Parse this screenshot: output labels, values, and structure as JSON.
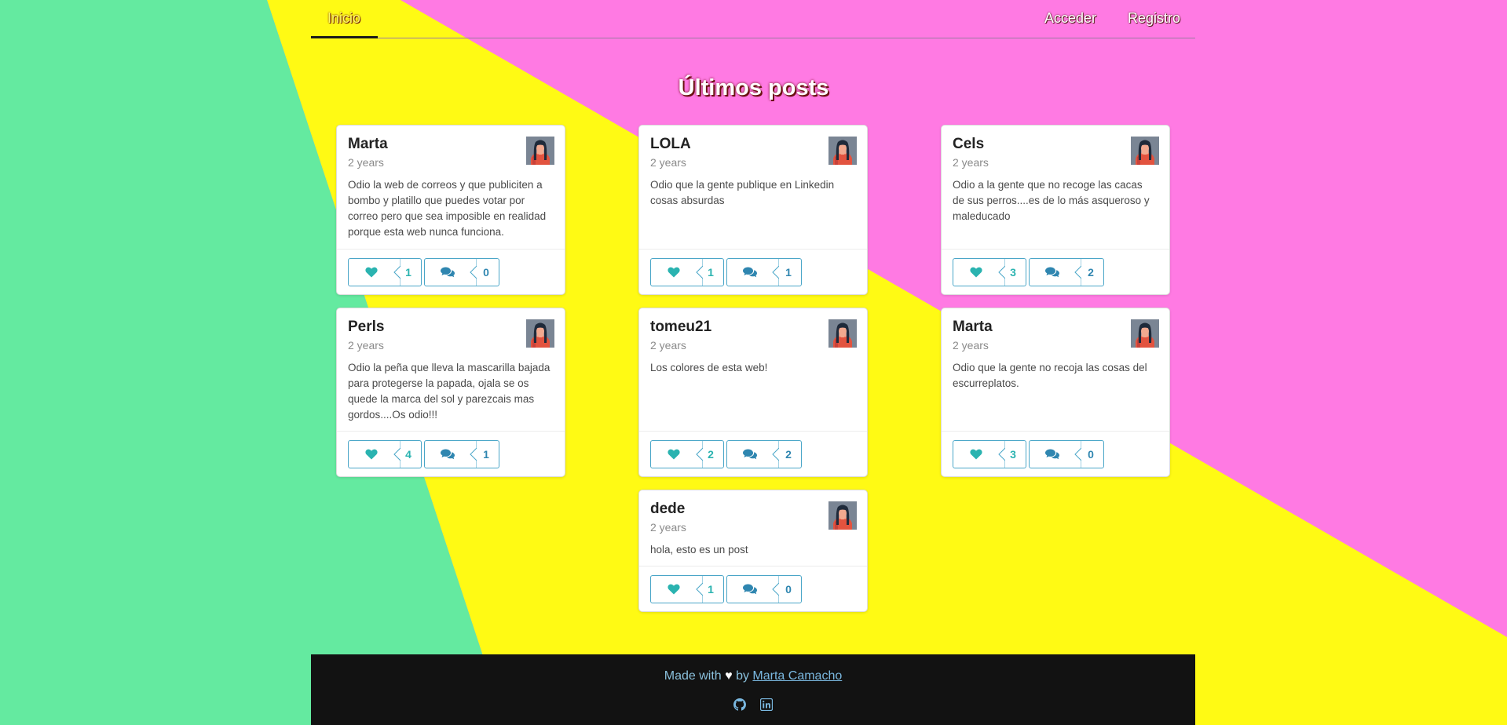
{
  "nav": {
    "home_label": "Inicio",
    "login_label": "Acceder",
    "register_label": "Registro"
  },
  "page": {
    "title": "Últimos posts"
  },
  "colors": {
    "background_pink": "#ff7ae3",
    "background_yellow": "#fffa14",
    "background_green": "#64eaa0",
    "accent_teal": "#2ab3b0",
    "accent_blue": "#2f86b0",
    "footer_bg": "#121212"
  },
  "posts": [
    {
      "author": "Marta",
      "time": "2 years",
      "text": "Odio la web de correos y que publiciten a bombo y platillo que puedes votar por correo pero que sea imposible en realidad porque esta web nunca funciona.",
      "likes": "1",
      "comments": "0"
    },
    {
      "author": "LOLA",
      "time": "2 years",
      "text": "Odio que la gente publique en Linkedin cosas absurdas",
      "likes": "1",
      "comments": "1"
    },
    {
      "author": "Cels",
      "time": "2 years",
      "text": "Odio a la gente que no recoge las cacas de sus perros....es de lo más asqueroso y maleducado",
      "likes": "3",
      "comments": "2"
    },
    {
      "author": "Perls",
      "time": "2 years",
      "text": "Odio la peña que lleva la mascarilla bajada para protegerse la papada, ojala se os quede la marca del sol y parezcais mas gordos....Os odio!!!",
      "likes": "4",
      "comments": "1"
    },
    {
      "author": "tomeu21",
      "time": "2 years",
      "text": "Los colores de esta web!",
      "likes": "2",
      "comments": "2"
    },
    {
      "author": "Marta",
      "time": "2 years",
      "text": "Odio que la gente no recoja las cosas del escurreplatos.",
      "likes": "3",
      "comments": "0"
    },
    {
      "author": "dede",
      "time": "2 years",
      "text": "hola, esto es un post",
      "likes": "1",
      "comments": "0"
    }
  ],
  "icons": {
    "like": "heart-icon",
    "comment": "comments-icon",
    "github": "github-icon",
    "linkedin": "linkedin-icon",
    "avatar": "avatar-illustration"
  },
  "footer": {
    "made_with": "Made with",
    "heart": "♥",
    "by": "by",
    "author_link": "Marta Camacho"
  }
}
